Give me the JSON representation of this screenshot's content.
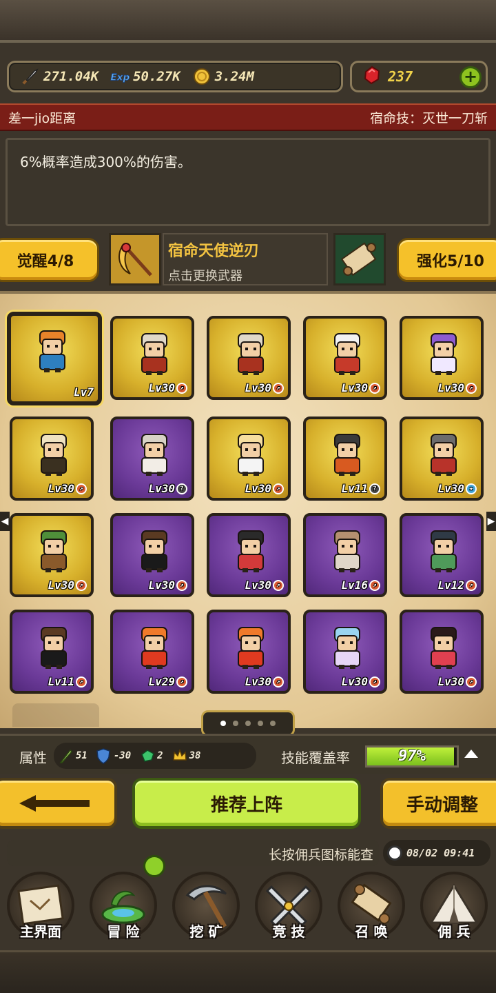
{
  "resources": {
    "attack": {
      "icon": "sword-icon",
      "value": "271.04K"
    },
    "exp": {
      "icon": "exp-icon",
      "value": "50.27K"
    },
    "gold": {
      "icon": "coin-icon",
      "value": "3.24M"
    },
    "gems": {
      "icon": "ruby-icon",
      "value": "237"
    }
  },
  "hero": {
    "name": "差一jio距离",
    "fate_skill": "宿命技：灭世一刀斩",
    "description": "6%概率造成300%的伤害。"
  },
  "weapon": {
    "awaken_label": "觉醒4/8",
    "name": "宿命天使逆刃",
    "hint": "点击更换武器",
    "enhance_label": "强化5/10"
  },
  "roster": [
    {
      "frame": "gold",
      "level": "Lv7",
      "badge": "",
      "selected": true
    },
    {
      "frame": "gold",
      "level": "Lv30",
      "badge": "arrow"
    },
    {
      "frame": "gold",
      "level": "Lv30",
      "badge": "arrow"
    },
    {
      "frame": "gold",
      "level": "Lv30",
      "badge": "arrow"
    },
    {
      "frame": "gold",
      "level": "Lv30",
      "badge": "arrow"
    },
    {
      "frame": "gold",
      "level": "Lv30",
      "badge": "arrow"
    },
    {
      "frame": "purple",
      "level": "Lv30",
      "badge": "question"
    },
    {
      "frame": "gold",
      "level": "Lv30",
      "badge": "arrow"
    },
    {
      "frame": "gold",
      "level": "Lv11",
      "badge": "question"
    },
    {
      "frame": "gold",
      "level": "Lv30",
      "badge": "star"
    },
    {
      "frame": "gold",
      "level": "Lv30",
      "badge": "arrow"
    },
    {
      "frame": "purple",
      "level": "Lv30",
      "badge": "arrow"
    },
    {
      "frame": "purple",
      "level": "Lv30",
      "badge": "arrow"
    },
    {
      "frame": "purple",
      "level": "Lv16",
      "badge": "arrow"
    },
    {
      "frame": "purple",
      "level": "Lv12",
      "badge": "arrow"
    },
    {
      "frame": "purple",
      "level": "Lv11",
      "badge": "arrow"
    },
    {
      "frame": "purple",
      "level": "Lv29",
      "badge": "arrow"
    },
    {
      "frame": "purple",
      "level": "Lv30",
      "badge": "arrow"
    },
    {
      "frame": "purple",
      "level": "Lv30",
      "badge": "arrow"
    },
    {
      "frame": "purple",
      "level": "Lv30",
      "badge": "arrow"
    }
  ],
  "pagination": {
    "total": 5,
    "current": 1
  },
  "stats": {
    "label": "属性",
    "items": [
      {
        "icon": "sword-stat-icon",
        "value": "51"
      },
      {
        "icon": "shield-stat-icon",
        "value": "-30"
      },
      {
        "icon": "gem-stat-icon",
        "value": "2"
      },
      {
        "icon": "crown-stat-icon",
        "value": "38"
      }
    ],
    "coverage_label": "技能覆盖率",
    "coverage_value": "97%",
    "coverage_fraction": 0.97
  },
  "actions": {
    "recommend": "推荐上阵",
    "manual": "手动调整"
  },
  "ticker": "长按佣兵图标能查",
  "clock": "08/02 09:41",
  "nav": [
    {
      "label": "主界面",
      "icon": "map-icon"
    },
    {
      "label": "冒 险",
      "icon": "island-icon"
    },
    {
      "label": "挖 矿",
      "icon": "pickaxe-icon"
    },
    {
      "label": "竞 技",
      "icon": "crossed-swords-icon"
    },
    {
      "label": "召 唤",
      "icon": "scroll-icon"
    },
    {
      "label": "佣 兵",
      "icon": "tent-icon"
    }
  ]
}
